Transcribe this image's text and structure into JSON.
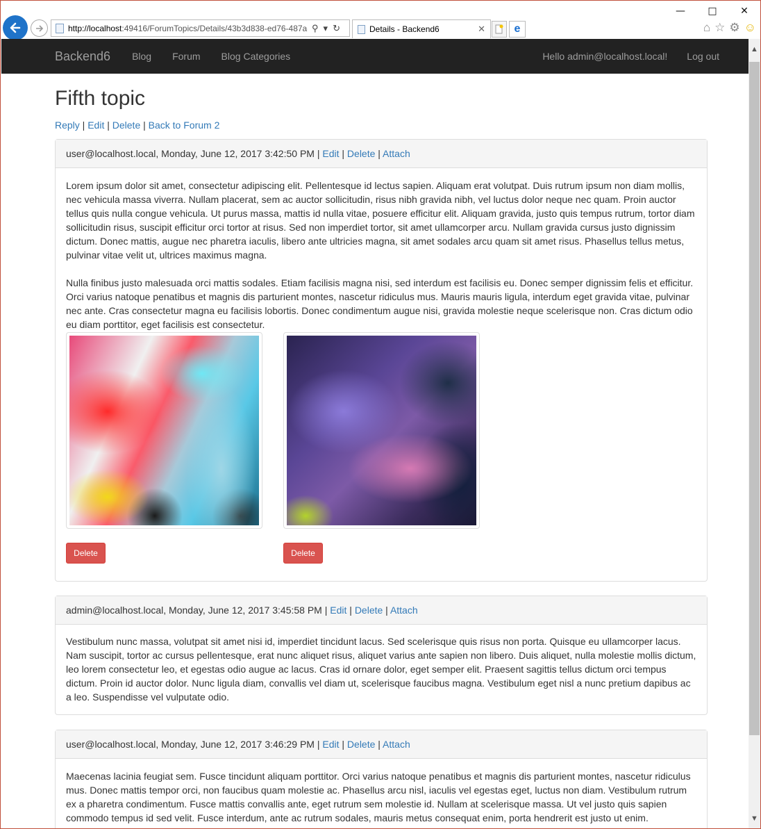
{
  "browser": {
    "address_host": "http://localhost",
    "address_rest": ":49416/ForumTopics/Details/43b3d838-ed76-487a-",
    "tab_title": "Details - Backend6"
  },
  "nav": {
    "brand": "Backend6",
    "links": [
      "Blog",
      "Forum",
      "Blog Categories"
    ],
    "greeting": "Hello admin@localhost.local!",
    "logout": "Log out"
  },
  "topic": {
    "title": "Fifth topic",
    "actions": [
      "Reply",
      "Edit",
      "Delete",
      "Back to Forum 2"
    ]
  },
  "post_actions": {
    "edit": "Edit",
    "delete": "Delete",
    "attach": "Attach"
  },
  "posts": [
    {
      "header": "user@localhost.local, Monday, June 12, 2017 3:42:50 PM",
      "paragraphs": [
        "Lorem ipsum dolor sit amet, consectetur adipiscing elit. Pellentesque id lectus sapien. Aliquam erat volutpat. Duis rutrum ipsum non diam mollis, nec vehicula massa viverra. Nullam placerat, sem ac auctor sollicitudin, risus nibh gravida nibh, vel luctus dolor neque nec quam. Proin auctor tellus quis nulla congue vehicula. Ut purus massa, mattis id nulla vitae, posuere efficitur elit. Aliquam gravida, justo quis tempus rutrum, tortor diam sollicitudin risus, suscipit efficitur orci tortor at risus. Sed non imperdiet tortor, sit amet ullamcorper arcu. Nullam gravida cursus justo dignissim dictum. Donec mattis, augue nec pharetra iaculis, libero ante ultricies magna, sit amet sodales arcu quam sit amet risus. Phasellus tellus metus, pulvinar vitae velit ut, ultrices maximus magna.",
        "Nulla finibus justo malesuada orci mattis sodales. Etiam facilisis magna nisi, sed interdum est facilisis eu. Donec semper dignissim felis et efficitur. Orci varius natoque penatibus et magnis dis parturient montes, nascetur ridiculus mus. Mauris mauris ligula, interdum eget gravida vitae, pulvinar nec ante. Cras consectetur magna eu facilisis lobortis. Donec condimentum augue nisi, gravida molestie neque scelerisque non. Cras dictum odio eu diam porttitor, eget facilisis est consectetur."
      ],
      "attachment_delete": "Delete"
    },
    {
      "header": "admin@localhost.local, Monday, June 12, 2017 3:45:58 PM",
      "paragraphs": [
        "Vestibulum nunc massa, volutpat sit amet nisi id, imperdiet tincidunt lacus. Sed scelerisque quis risus non porta. Quisque eu ullamcorper lacus. Nam suscipit, tortor ac cursus pellentesque, erat nunc aliquet risus, aliquet varius ante sapien non libero. Duis aliquet, nulla molestie mollis dictum, leo lorem consectetur leo, et egestas odio augue ac lacus. Cras id ornare dolor, eget semper elit. Praesent sagittis tellus dictum orci tempus dictum. Proin id auctor dolor. Nunc ligula diam, convallis vel diam ut, scelerisque faucibus magna. Vestibulum eget nisl a nunc pretium dapibus ac a leo. Suspendisse vel vulputate odio."
      ]
    },
    {
      "header": "user@localhost.local, Monday, June 12, 2017 3:46:29 PM",
      "paragraphs": [
        "Maecenas lacinia feugiat sem. Fusce tincidunt aliquam porttitor. Orci varius natoque penatibus et magnis dis parturient montes, nascetur ridiculus mus. Donec mattis tempor orci, non faucibus quam molestie ac. Phasellus arcu nisl, iaculis vel egestas eget, luctus non diam. Vestibulum rutrum ex a pharetra condimentum. Fusce mattis convallis ante, eget rutrum sem molestie id. Nullam at scelerisque massa. Ut vel justo quis sapien commodo tempus id sed velit. Fusce interdum, ante ac rutrum sodales, mauris metus consequat enim, porta hendrerit est justo ut enim. Vestibulum eu faucibus ipsum, eget mattis orci."
      ]
    }
  ]
}
